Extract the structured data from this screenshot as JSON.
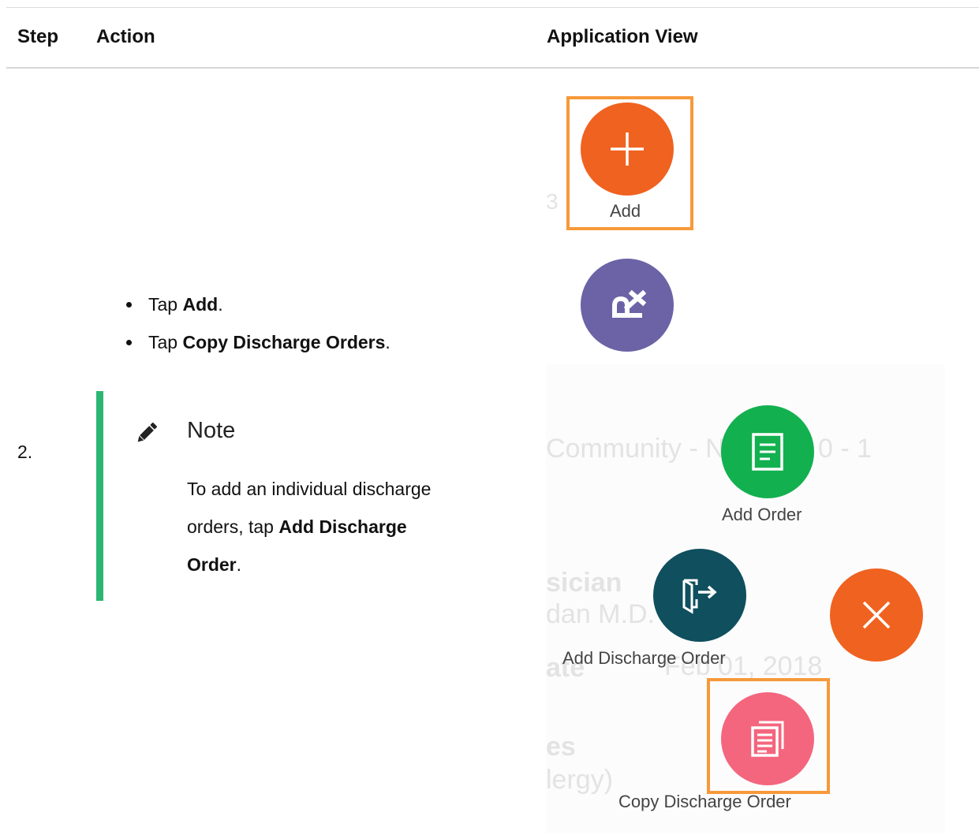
{
  "table": {
    "headers": {
      "step": "Step",
      "action": "Action",
      "view": "Application View"
    },
    "row": {
      "step": "2.",
      "bullets": [
        {
          "prefix": "Tap ",
          "bold": "Add",
          "suffix": "."
        },
        {
          "prefix": "Tap ",
          "bold": "Copy Discharge Orders",
          "suffix": "."
        }
      ],
      "note": {
        "title": "Note",
        "body_prefix": "To add an individual discharge orders, tap ",
        "body_bold": "Add Discharge Order",
        "body_suffix": "."
      }
    }
  },
  "app_view": {
    "buttons": {
      "add_label": "Add",
      "add_order_label": "Add Order",
      "add_discharge_order_label": "Add Discharge Order",
      "copy_discharge_order_label": "Copy Discharge Order"
    },
    "background_text": {
      "community": "Community  - N",
      "community_tail": "0 - 1",
      "physician": "sician",
      "physician_name": "dan M.D.",
      "date_label": "ate",
      "date_value": "Feb 01, 2018",
      "allergies": "es",
      "allergy_value": "lergy)",
      "partial_num": "3"
    },
    "colors": {
      "add": "#f0621f",
      "rx": "#6b63a6",
      "add_order": "#13b04f",
      "add_discharge": "#0f4f5e",
      "close": "#f0621f",
      "copy_discharge": "#f4667e",
      "highlight": "#f7993a"
    },
    "icons": {
      "add": "plus-icon",
      "rx": "rx-icon",
      "add_order": "document-icon",
      "add_discharge": "exit-door-icon",
      "close": "close-icon",
      "copy_discharge": "copy-document-icon"
    }
  }
}
